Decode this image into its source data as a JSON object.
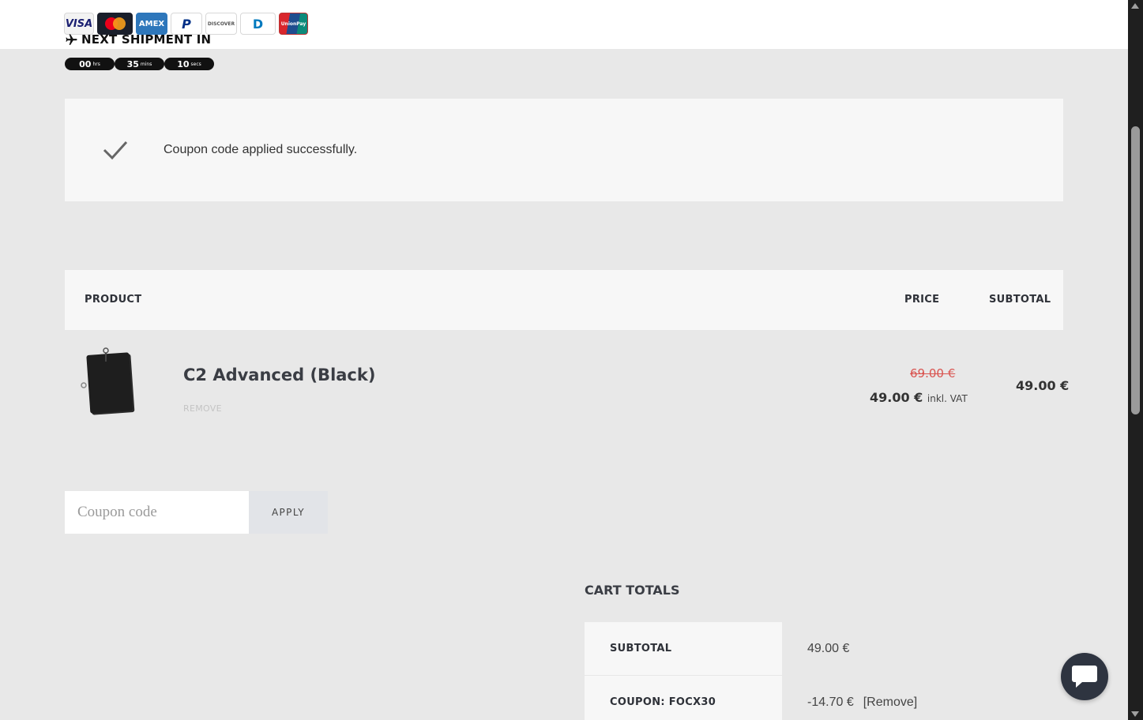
{
  "header": {
    "payment_methods": [
      {
        "name": "visa-icon",
        "label": "VISA"
      },
      {
        "name": "mastercard-icon",
        "label": ""
      },
      {
        "name": "amex-icon",
        "label": "AMEX"
      },
      {
        "name": "paypal-icon",
        "label": "P"
      },
      {
        "name": "discover-icon",
        "label": "DISCOVER"
      },
      {
        "name": "diners-icon",
        "label": "D"
      },
      {
        "name": "unionpay-icon",
        "label": "UnionPay"
      }
    ],
    "shipment_title": "NEXT SHIPMENT IN",
    "timer": {
      "hours": "00",
      "hours_unit": "hrs",
      "mins": "35",
      "mins_unit": "mins",
      "secs": "10",
      "secs_unit": "secs"
    }
  },
  "notice": {
    "message": "Coupon code applied successfully."
  },
  "cart_table": {
    "headers": {
      "product": "PRODUCT",
      "price": "PRICE",
      "subtotal": "SUBTOTAL"
    },
    "items": [
      {
        "name": "C2 Advanced (Black)",
        "remove_label": "REMOVE",
        "old_price": "69.00 €",
        "new_price": "49.00 €",
        "vat_note": "inkl. VAT",
        "subtotal": "49.00 €"
      }
    ]
  },
  "coupon": {
    "placeholder": "Coupon code",
    "apply_label": "APPLY"
  },
  "cart_totals": {
    "title": "CART TOTALS",
    "rows": [
      {
        "label": "SUBTOTAL",
        "value": "49.00 €",
        "action": ""
      },
      {
        "label": "COUPON: FOCX30",
        "value": "-14.70 €",
        "action": "[Remove]"
      }
    ]
  },
  "colors": {
    "accent": "#2e3440",
    "strike_price": "#d9534f",
    "background": "#e8e8e8"
  }
}
